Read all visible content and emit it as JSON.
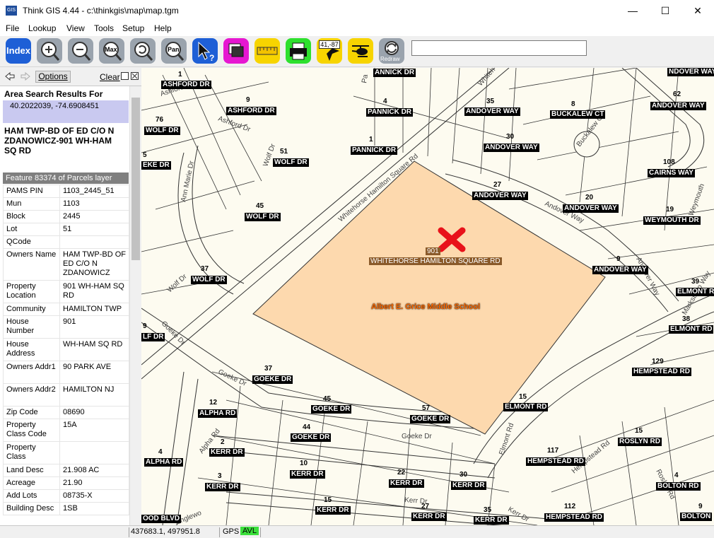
{
  "window": {
    "title": "Think GIS 4.44 - c:\\thinkgis\\map\\map.tgm",
    "minimize": "—",
    "maximize": "☐",
    "close": "✕",
    "app_icon_text": "GIS"
  },
  "menu": [
    "File",
    "Lookup",
    "View",
    "Tools",
    "Setup",
    "Help"
  ],
  "toolbar": {
    "index_label": "Index",
    "max_label": "Max",
    "pan_label": "Pan",
    "coords_label": "41,-87",
    "redraw_label": "Redraw",
    "search_value": "",
    "buttons": [
      {
        "icon": "index-icon",
        "color": "#1e5fd6"
      },
      {
        "icon": "zoom-in-icon",
        "color": "#9aa3ad"
      },
      {
        "icon": "zoom-out-icon",
        "color": "#9aa3ad"
      },
      {
        "icon": "zoom-max-icon",
        "color": "#9aa3ad"
      },
      {
        "icon": "zoom-previous-icon",
        "color": "#9aa3ad"
      },
      {
        "icon": "pan-icon",
        "color": "#9aa3ad"
      },
      {
        "icon": "identify-icon",
        "color": "#1e5fd6"
      },
      {
        "icon": "layers-icon",
        "color": "#e617d1"
      },
      {
        "icon": "measure-icon",
        "color": "#f7d400"
      },
      {
        "icon": "print-icon",
        "color": "#2ee02e"
      },
      {
        "icon": "gps-icon",
        "color": "#f7d400"
      },
      {
        "icon": "helicopter-icon",
        "color": "#f7d400"
      },
      {
        "icon": "redraw-icon",
        "color": "#9aa3ad"
      }
    ]
  },
  "panel": {
    "options_label": "Options",
    "clear_label": "Clear",
    "results_title": "Area Search Results For",
    "coords": "40.2022039, -74.6908451",
    "owner_title": "HAM TWP-BD OF ED C/O N ZDANOWICZ-901 WH-HAM SQ RD",
    "feature_header": "Feature 83374 of Parcels layer",
    "rows": [
      {
        "k": "PAMS PIN",
        "v": "1103_2445_51"
      },
      {
        "k": "Mun",
        "v": "1103"
      },
      {
        "k": "Block",
        "v": "2445"
      },
      {
        "k": "Lot",
        "v": "51"
      },
      {
        "k": "QCode",
        "v": ""
      },
      {
        "k": "Owners Name",
        "v": "HAM TWP-BD OF ED C/O N ZDANOWICZ"
      },
      {
        "k": "Property Location",
        "v": "901 WH-HAM SQ RD"
      },
      {
        "k": "Community",
        "v": "HAMILTON TWP"
      },
      {
        "k": "House Number",
        "v": "901"
      },
      {
        "k": "House Address",
        "v": "WH-HAM SQ RD"
      },
      {
        "k": "Owners Addr1",
        "v": "90 PARK AVE"
      },
      {
        "k": "Owners Addr2",
        "v": "HAMILTON NJ"
      },
      {
        "k": "Zip Code",
        "v": "08690"
      },
      {
        "k": "Property Class Code",
        "v": "15A"
      },
      {
        "k": "Property Class",
        "v": ""
      },
      {
        "k": "Land Desc",
        "v": "21.908 AC"
      },
      {
        "k": "Acreage",
        "v": "21.90"
      },
      {
        "k": "Add Lots",
        "v": "08735-X"
      },
      {
        "k": "Building Desc",
        "v": "1SB"
      }
    ]
  },
  "status": {
    "coords": "437683.1, 497951.8",
    "gps": "GPS",
    "avl": "AVL"
  },
  "map": {
    "selected_number": "901",
    "selected_street": "WHITEHORSE HAMILTON SQUARE RD",
    "school": "Albert E. Grice Middle School",
    "street_labels": [
      {
        "text": "Whitehorse Hamilton Square Rd"
      },
      {
        "text": "Ashford Dr"
      },
      {
        "text": "Ashford Dr"
      },
      {
        "text": "Ann Marie Dr"
      },
      {
        "text": "Wolf Dr"
      },
      {
        "text": "Wolf Dr"
      },
      {
        "text": "Goeke Dr"
      },
      {
        "text": "Goeke Dr"
      },
      {
        "text": "Goeke Dr"
      },
      {
        "text": "Andover Way"
      },
      {
        "text": "Andover Way"
      },
      {
        "text": "Buckalew Ct"
      },
      {
        "text": "Elmont Rd"
      },
      {
        "text": "Kerr Dr"
      },
      {
        "text": "Kerr Dr"
      },
      {
        "text": "Alpha Rd"
      },
      {
        "text": "Hempstead Rd"
      },
      {
        "text": "Roslyn Rd"
      },
      {
        "text": "Marksboro Way"
      },
      {
        "text": "Weymouth"
      },
      {
        "text": "Pa"
      },
      {
        "text": "Whiteh"
      },
      {
        "text": "Englewo"
      }
    ],
    "labels": [
      {
        "num": "1",
        "street": "ASHFORD DR"
      },
      {
        "num": "9",
        "street": "ASHFORD DR"
      },
      {
        "num": "76",
        "street": "WOLF DR"
      },
      {
        "num": "5",
        "street": "EKE DR"
      },
      {
        "num": "51",
        "street": "WOLF DR"
      },
      {
        "num": "45",
        "street": "WOLF DR"
      },
      {
        "num": "37",
        "street": "WOLF DR"
      },
      {
        "num": "9",
        "street": "LF DR"
      },
      {
        "num": "",
        "street": "ANNICK DR"
      },
      {
        "num": "4",
        "street": "PANNICK DR"
      },
      {
        "num": "1",
        "street": "PANNICK DR"
      },
      {
        "num": "35",
        "street": "ANDOVER WAY"
      },
      {
        "num": "30",
        "street": "ANDOVER WAY"
      },
      {
        "num": "27",
        "street": "ANDOVER WAY"
      },
      {
        "num": "8",
        "street": "BUCKALEW CT"
      },
      {
        "num": "",
        "street": "NDOVER WAY"
      },
      {
        "num": "62",
        "street": "ANDOVER WAY"
      },
      {
        "num": "108",
        "street": "CAIRNS WAY"
      },
      {
        "num": "20",
        "street": "ANDOVER WAY"
      },
      {
        "num": "19",
        "street": "WEYMOUTH DR"
      },
      {
        "num": "9",
        "street": "ANDOVER WAY"
      },
      {
        "num": "39",
        "street": "ELMONT RD"
      },
      {
        "num": "38",
        "street": "ELMONT RD"
      },
      {
        "num": "129",
        "street": "HEMPSTEAD RD"
      },
      {
        "num": "15",
        "street": "ELMONT RD"
      },
      {
        "num": "37",
        "street": "GOEKE DR"
      },
      {
        "num": "45",
        "street": "GOEKE DR"
      },
      {
        "num": "57",
        "street": "GOEKE DR"
      },
      {
        "num": "44",
        "street": "GOEKE DR"
      },
      {
        "num": "12",
        "street": "ALPHA RD"
      },
      {
        "num": "2",
        "street": "KERR DR"
      },
      {
        "num": "4",
        "street": "ALPHA RD"
      },
      {
        "num": "10",
        "street": "KERR DR"
      },
      {
        "num": "22",
        "street": "KERR DR"
      },
      {
        "num": "30",
        "street": "KERR DR"
      },
      {
        "num": "3",
        "street": "KERR DR"
      },
      {
        "num": "15",
        "street": "KERR DR"
      },
      {
        "num": "27",
        "street": "KERR DR"
      },
      {
        "num": "35",
        "street": "KERR DR"
      },
      {
        "num": "",
        "street": "OOD BLVD"
      },
      {
        "num": "117",
        "street": "HEMPSTEAD RD"
      },
      {
        "num": "15",
        "street": "ROSLYN RD"
      },
      {
        "num": "4",
        "street": "BOLTON RD"
      },
      {
        "num": "112",
        "street": "HEMPSTEAD RD"
      },
      {
        "num": "9",
        "street": "BOLTON"
      }
    ]
  }
}
